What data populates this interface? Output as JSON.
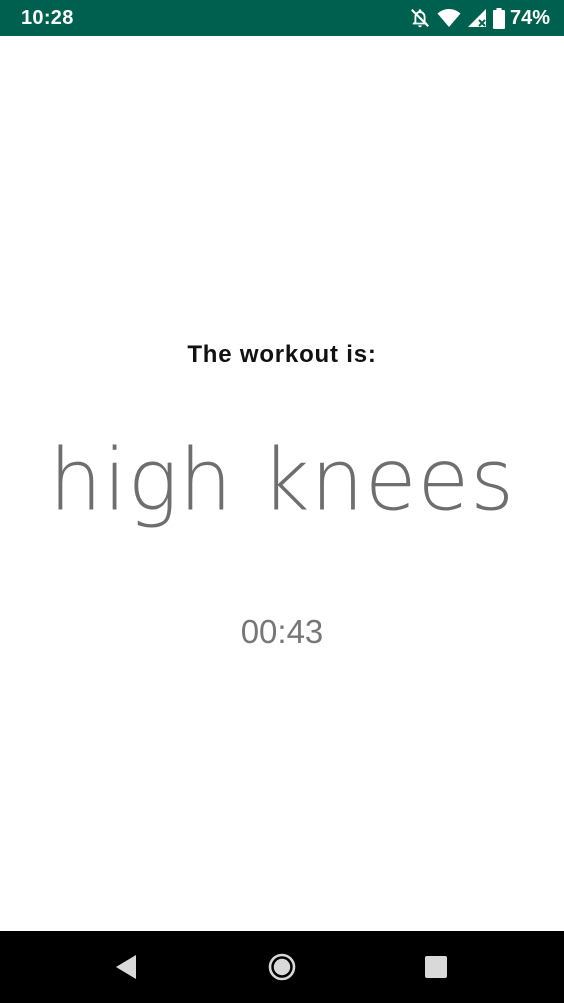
{
  "status_bar": {
    "time": "10:28",
    "icons": [
      "notifications-off-icon",
      "wifi-icon",
      "cell-signal-icon",
      "battery-icon"
    ],
    "battery_percent": "74%",
    "background_color": "#00604f"
  },
  "main": {
    "heading": "The workout is:",
    "workout_name": "high knees",
    "timer": "00:43"
  },
  "nav_bar": {
    "buttons": [
      "back-icon",
      "home-icon",
      "recents-icon"
    ],
    "background_color": "#000000"
  }
}
